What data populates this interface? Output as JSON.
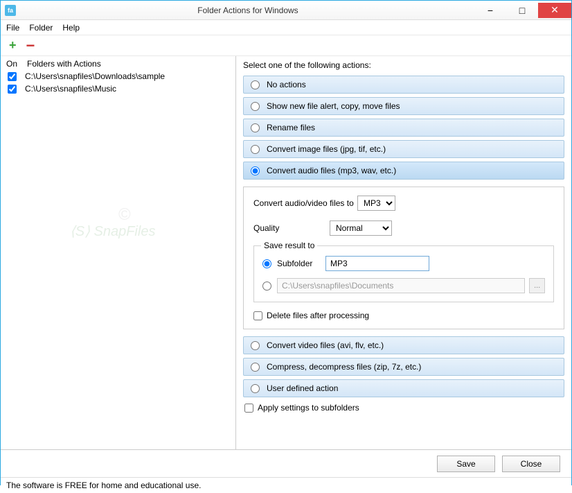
{
  "window": {
    "title": "Folder Actions for Windows",
    "icon_text": "fa"
  },
  "menu": {
    "file": "File",
    "folder": "Folder",
    "help": "Help"
  },
  "toolbar": {
    "add": "+",
    "remove": "−"
  },
  "left": {
    "col_on": "On",
    "col_folders": "Folders with Actions",
    "rows": [
      {
        "checked": true,
        "path": "C:\\Users\\snapfiles\\Downloads\\sample"
      },
      {
        "checked": true,
        "path": "C:\\Users\\snapfiles\\Music"
      }
    ]
  },
  "right": {
    "header": "Select one of the following actions:",
    "options": {
      "no_actions": "No actions",
      "show_new_file": "Show new file alert, copy, move files",
      "rename": "Rename files",
      "convert_image": "Convert image files (jpg, tif, etc.)",
      "convert_audio": "Convert audio files (mp3, wav, etc.)",
      "convert_video": "Convert video files (avi, flv, etc.)",
      "compress": "Compress, decompress files (zip, 7z, etc.)",
      "user_defined": "User defined action"
    },
    "selected": "convert_audio",
    "details": {
      "convert_to_label": "Convert audio/video files to",
      "convert_to_value": "MP3",
      "quality_label": "Quality",
      "quality_value": "Normal",
      "save_result_legend": "Save result to",
      "subfolder_label": "Subfolder",
      "subfolder_value": "MP3",
      "path_value": "C:\\Users\\snapfiles\\Documents",
      "browse_label": "...",
      "delete_after": "Delete files after processing"
    },
    "apply_subfolders": "Apply settings to subfolders"
  },
  "buttons": {
    "save": "Save",
    "close": "Close"
  },
  "statusbar": "The software is FREE for home and educational use."
}
